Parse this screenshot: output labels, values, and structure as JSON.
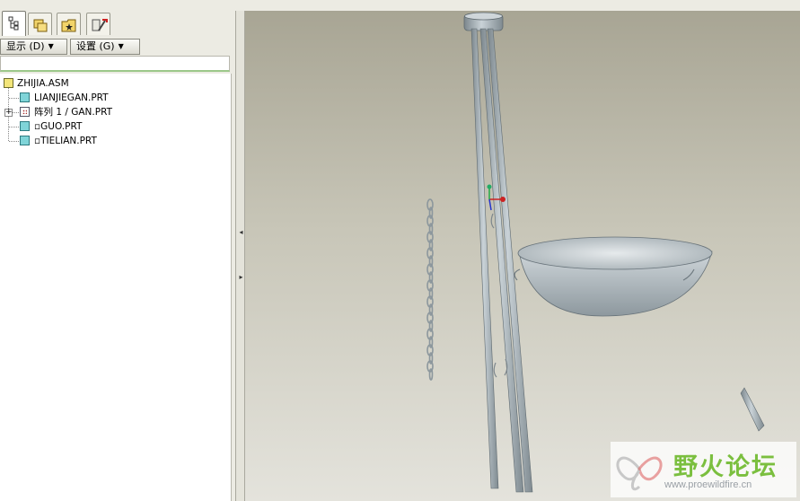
{
  "navigator": {
    "tabs": [
      {
        "name": "model-tree-icon"
      },
      {
        "name": "folder-browser-icon"
      },
      {
        "name": "favorites-icon"
      },
      {
        "name": "connections-icon"
      }
    ],
    "toolbar": {
      "show_label": "显示 (D)",
      "settings_label": "设置 (G)"
    },
    "filter_value": "",
    "tree": {
      "root": "ZHIJIA.ASM",
      "items": [
        {
          "label": "LIANJIEGAN.PRT",
          "icon": "part-icon"
        },
        {
          "label": "阵列 1 / GAN.PRT",
          "icon": "pattern-icon"
        },
        {
          "label": "▫GUO.PRT",
          "icon": "part-icon"
        },
        {
          "label": "▫TIELIAN.PRT",
          "icon": "part-icon"
        }
      ]
    }
  },
  "watermark": {
    "title": "野火论坛",
    "url": "www.proewildfire.cn"
  },
  "colors": {
    "part_color": "#a4b0b6",
    "datum_x": "#cc2222",
    "datum_y": "#22aa44",
    "datum_z": "#2233cc",
    "watermark_green": "#7bbf3f"
  }
}
